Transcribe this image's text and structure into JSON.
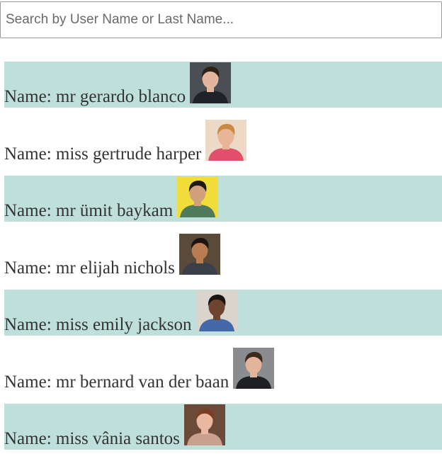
{
  "search": {
    "placeholder": "Search by User Name or Last Name..."
  },
  "users": [
    {
      "label": "Name: mr gerardo blanco",
      "avatar": "man-portrait-dark-suit",
      "bg": "#4a4e55",
      "skin": "#e2b69c",
      "hair": "#2e2218",
      "shirt": "#1f2328"
    },
    {
      "label": "Name: miss gertrude harper",
      "avatar": "woman-portrait-blonde",
      "bg": "#ecd9c6",
      "skin": "#e8b596",
      "hair": "#c98a3f",
      "shirt": "#e24f6c"
    },
    {
      "label": "Name: mr ümit baykam",
      "avatar": "man-portrait-yellow-bg",
      "bg": "#f0dc3a",
      "skin": "#d2a07a",
      "hair": "#1d1a17",
      "shirt": "#4f7a5c"
    },
    {
      "label": "Name: mr elijah nichols",
      "avatar": "man-portrait-smiling",
      "bg": "#5a4a3a",
      "skin": "#b97d52",
      "hair": "#1b1410",
      "shirt": "#3b3f4a"
    },
    {
      "label": "Name: miss emily jackson",
      "avatar": "woman-portrait-curly-hair",
      "bg": "#d9d4cc",
      "skin": "#6e4430",
      "hair": "#1a1412",
      "shirt": "#4568a8"
    },
    {
      "label": "Name: mr bernard van der baan",
      "avatar": "man-portrait-grey-bg",
      "bg": "#8a8c8f",
      "skin": "#e0b59a",
      "hair": "#3b2a1d",
      "shirt": "#1e2024"
    },
    {
      "label": "Name: miss vânia santos",
      "avatar": "woman-portrait-brown-hair",
      "bg": "#6b4a3a",
      "skin": "#eab8a0",
      "hair": "#7a3e22",
      "shirt": "#c9a090"
    }
  ],
  "colors": {
    "stripe": "#bfdfda",
    "text": "#333333"
  }
}
